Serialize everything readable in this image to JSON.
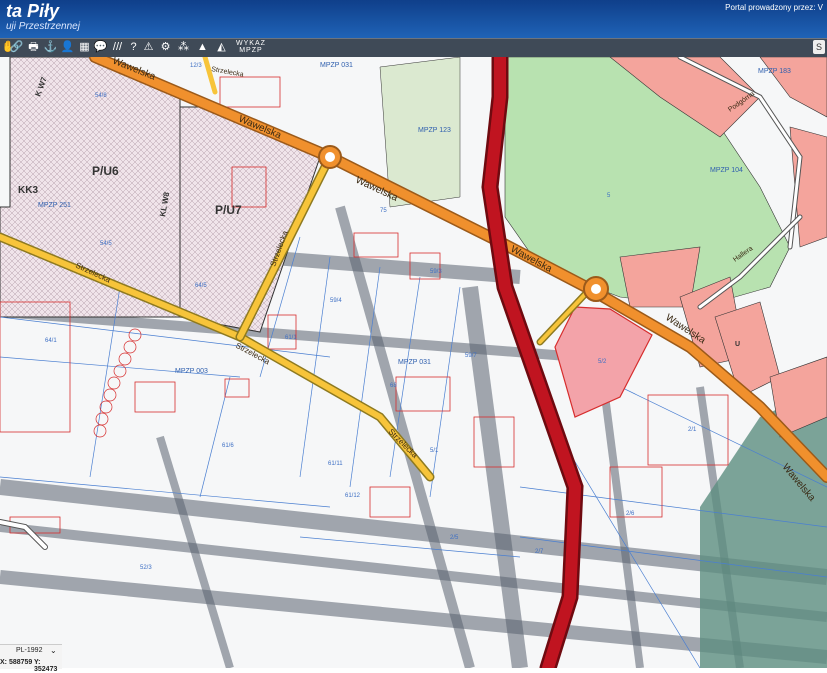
{
  "header": {
    "title": "ta Piły",
    "subtitle": "uji Przestrzennej",
    "portal_text": "Portal prowadzony przez: V"
  },
  "toolbar": {
    "icons": [
      "hand-icon",
      "link-icon",
      "print-icon",
      "anchor-icon",
      "user-icon",
      "table-icon",
      "comment-icon",
      "hatch-icon",
      "help-icon",
      "warning-icon",
      "measure-icon",
      "network-icon",
      "mountain-icon",
      "layers-icon"
    ],
    "wykaz_line1": "WYKAZ",
    "wykaz_line2": "MPZP",
    "search_label": "S"
  },
  "map": {
    "streets": {
      "wawelska_1": "Wawelska",
      "wawelska_2": "Wawelska",
      "wawelska_3": "Wawelska",
      "wawelska_4": "Wawelska",
      "wawelska_5": "Wawelska",
      "wawelska_6": "Wawelska",
      "strzelecka_1": "Strzelecka",
      "strzelecka_2": "Strzelecka",
      "strzelecka_3": "Strzelecka",
      "strzelecka_4": "Strzelecka",
      "strzelecka_5": "Strzelecka",
      "podgorna": "Podgórna",
      "hallera": "Hallera"
    },
    "zones": {
      "pu6": "P/U6",
      "pu7": "P/U7",
      "kk3": "KK3",
      "kw7": "K W7",
      "kw8": "KL W8",
      "u": "U"
    },
    "mpzp": {
      "m251": "MPZP 251",
      "m123": "MPZP 123",
      "m031a": "MPZP 031",
      "m031b": "MPZP 031",
      "m003": "MPZP 003",
      "m104": "MPZP 104",
      "m183": "MPZP 183"
    },
    "parcels": [
      "64/1",
      "54/5",
      "64/5",
      "61/1",
      "59/4",
      "59/3",
      "61/6",
      "61/12",
      "61/11",
      "54/8",
      "59/7",
      "5/1",
      "2/1",
      "2/5",
      "2/7",
      "2/6",
      "52/3",
      "12/3",
      "75",
      "68",
      "5",
      "5/2"
    ]
  },
  "coords": {
    "crs": "PL-1992",
    "x_label": "X: 588759",
    "y_label": "Y: 352473"
  }
}
